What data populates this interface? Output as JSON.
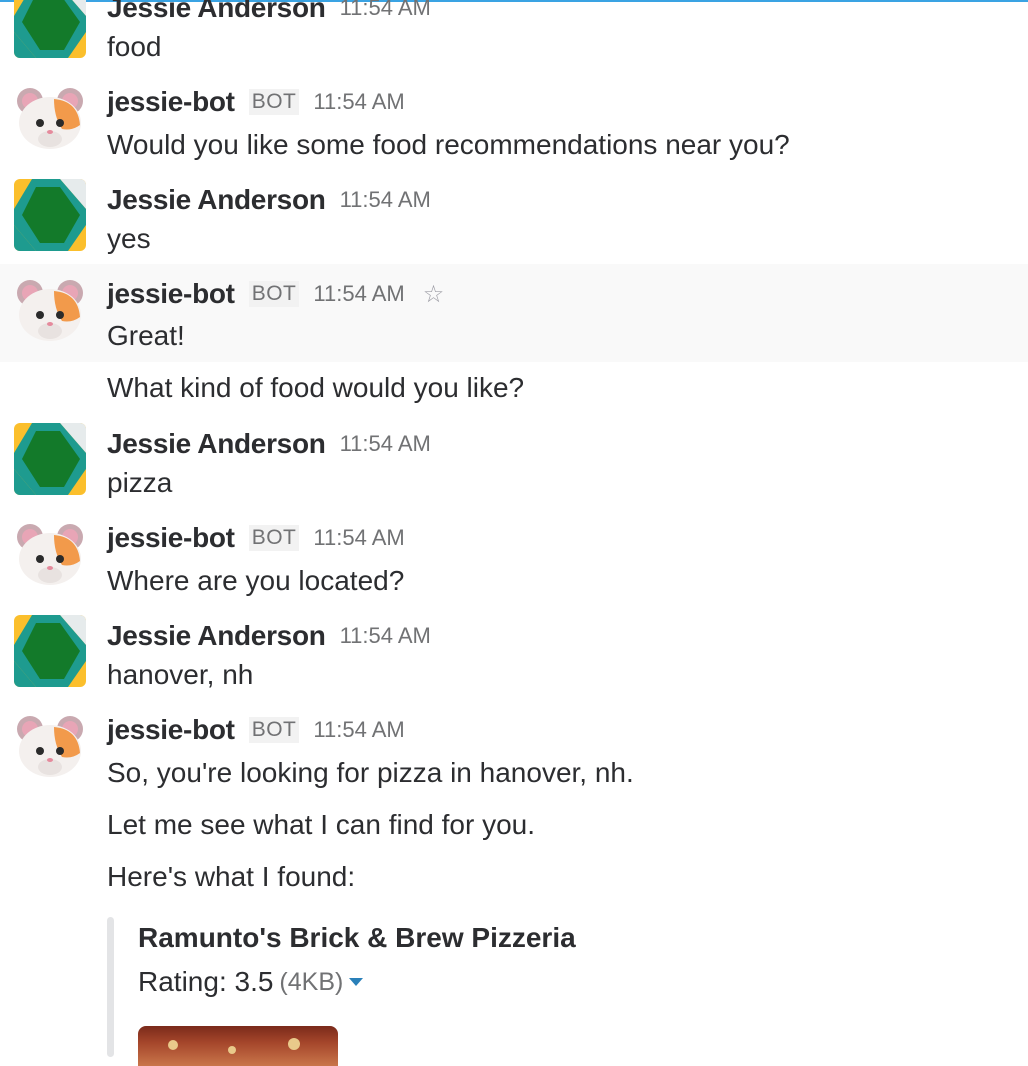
{
  "messages": [
    {
      "sender": "Jessie Anderson",
      "bot": false,
      "time": "11:54 AM",
      "lines": [
        "food"
      ]
    },
    {
      "sender": "jessie-bot",
      "bot": true,
      "time": "11:54 AM",
      "lines": [
        "Would you like some food recommendations near you?"
      ]
    },
    {
      "sender": "Jessie Anderson",
      "bot": false,
      "time": "11:54 AM",
      "lines": [
        "yes"
      ]
    },
    {
      "sender": "jessie-bot",
      "bot": true,
      "time": "11:54 AM",
      "lines": [
        "Great!",
        "What kind of food would you like?"
      ]
    },
    {
      "sender": "Jessie Anderson",
      "bot": false,
      "time": "11:54 AM",
      "lines": [
        "pizza"
      ]
    },
    {
      "sender": "jessie-bot",
      "bot": true,
      "time": "11:54 AM",
      "lines": [
        "Where are you located?"
      ]
    },
    {
      "sender": "Jessie Anderson",
      "bot": false,
      "time": "11:54 AM",
      "lines": [
        "hanover, nh"
      ]
    },
    {
      "sender": "jessie-bot",
      "bot": true,
      "time": "11:54 AM",
      "lines": [
        "So, you're looking for pizza in hanover, nh.",
        "Let me see what I can find for you.",
        "Here's what I found:"
      ]
    }
  ],
  "bot_badge": "BOT",
  "attachment": {
    "title": "Ramunto's Brick & Brew Pizzeria",
    "rating": "Rating: 3.5",
    "size": "(4KB)"
  },
  "icons": {
    "star": "star-icon",
    "expand": "caret-down-icon",
    "user_avatar": "user-avatar",
    "bot_avatar": "hamster-avatar"
  },
  "colors": {
    "accent": "#3aa3e3",
    "link": "#2a80b9",
    "hover_bg": "#f9f9f9"
  }
}
